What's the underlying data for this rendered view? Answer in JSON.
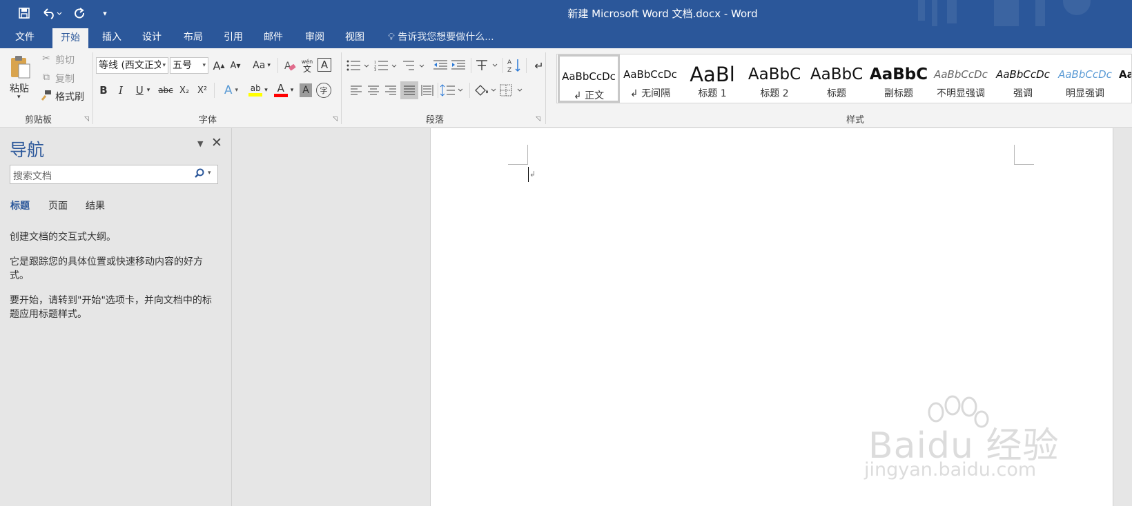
{
  "window": {
    "title": "新建 Microsoft Word 文档.docx - Word"
  },
  "qat": {
    "save_icon": "save-icon",
    "undo_icon": "undo-icon",
    "redo_icon": "redo-icon",
    "customize_icon": "customize-qat-icon"
  },
  "tabs": [
    "文件",
    "开始",
    "插入",
    "设计",
    "布局",
    "引用",
    "邮件",
    "审阅",
    "视图"
  ],
  "active_tab": "开始",
  "tellme": "告诉我您想要做什么...",
  "clipboard": {
    "paste": "粘贴",
    "cut": "剪切",
    "copy": "复制",
    "format_painter": "格式刷",
    "label": "剪贴板"
  },
  "font": {
    "name": "等线 (西文正文",
    "size": "五号",
    "grow": "A",
    "shrink": "A",
    "change_case": "Aa",
    "phonetic": "wén",
    "phonetic_sub": "文",
    "border_char": "A",
    "bold": "B",
    "italic": "I",
    "underline": "U",
    "strike": "abc",
    "subscript": "X₂",
    "superscript": "X²",
    "text_effect": "A",
    "highlight": "ab",
    "font_color": "A",
    "char_shading": "A",
    "enclose": "字",
    "label": "字体"
  },
  "paragraph": {
    "label": "段落"
  },
  "styles": {
    "label": "样式",
    "items": [
      {
        "sample": "AaBbCcDc",
        "name": "↲ 正文"
      },
      {
        "sample": "AaBbCcDc",
        "name": "↲ 无间隔"
      },
      {
        "sample": "AaBl",
        "name": "标题 1"
      },
      {
        "sample": "AaBbC",
        "name": "标题 2"
      },
      {
        "sample": "AaBbC",
        "name": "标题"
      },
      {
        "sample": "AaBbC",
        "name": "副标题"
      },
      {
        "sample": "AaBbCcDc",
        "name": "不明显强调"
      },
      {
        "sample": "AaBbCcDc",
        "name": "强调"
      },
      {
        "sample": "AaBbCcDc",
        "name": "明显强调"
      },
      {
        "sample": "Aa",
        "name": ""
      }
    ]
  },
  "nav": {
    "title": "导航",
    "search_placeholder": "搜索文档",
    "tabs": [
      "标题",
      "页面",
      "结果"
    ],
    "para1": "创建文档的交互式大纲。",
    "para2": "它是跟踪您的具体位置或快速移动内容的好方式。",
    "para3": "要开始，请转到\"开始\"选项卡，并向文档中的标题应用标题样式。"
  },
  "document": {
    "paragraph_mark": "↲"
  },
  "watermark": {
    "line1": "Baidu 经验",
    "line2": "jingyan.baidu.com"
  },
  "colors": {
    "accent": "#2b579a",
    "highlight": "#ffff00",
    "font_color": "#ff0000"
  }
}
